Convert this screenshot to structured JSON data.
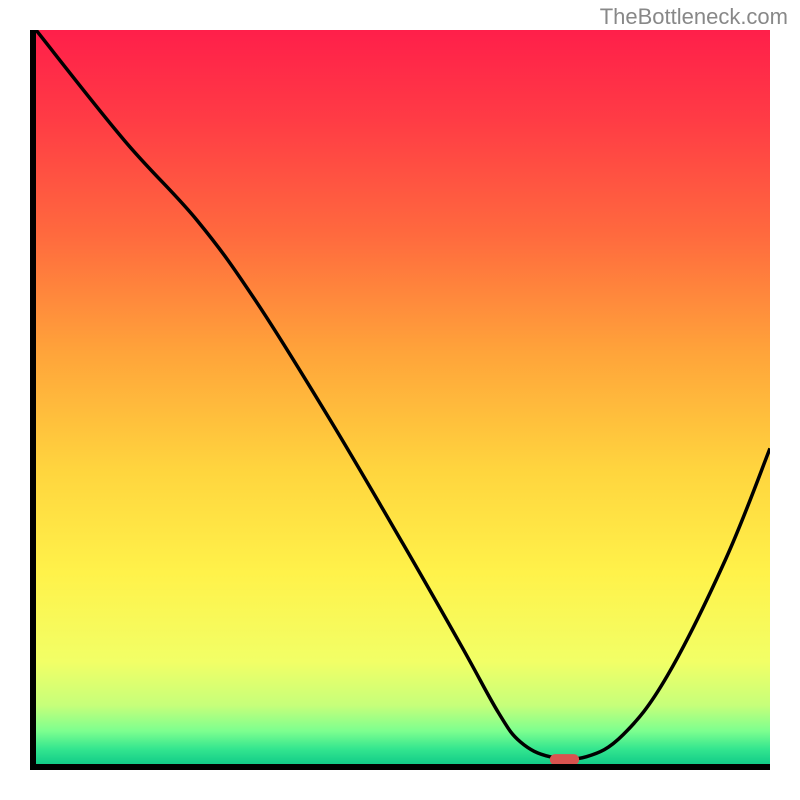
{
  "watermark": "TheBottleneck.com",
  "chart_data": {
    "type": "line",
    "title": "",
    "xlabel": "",
    "ylabel": "",
    "xlim": [
      0,
      100
    ],
    "ylim": [
      0,
      100
    ],
    "series": [
      {
        "name": "curve",
        "x": [
          0,
          12,
          22,
          30,
          40,
          50,
          58,
          63,
          66,
          70,
          75,
          80,
          86,
          94,
          100
        ],
        "values": [
          100,
          85,
          74,
          63,
          47,
          30,
          16,
          7,
          3,
          1,
          1,
          4,
          12,
          28,
          43
        ]
      }
    ],
    "marker": {
      "x": 72,
      "y": 0.6,
      "width": 4,
      "height": 1.5
    },
    "gradient_stops": [
      {
        "offset": 0,
        "color": "#ff1f4a"
      },
      {
        "offset": 0.12,
        "color": "#ff3b45"
      },
      {
        "offset": 0.28,
        "color": "#ff6a3e"
      },
      {
        "offset": 0.44,
        "color": "#ffa43a"
      },
      {
        "offset": 0.6,
        "color": "#ffd53e"
      },
      {
        "offset": 0.74,
        "color": "#fff24a"
      },
      {
        "offset": 0.86,
        "color": "#f2ff66"
      },
      {
        "offset": 0.92,
        "color": "#c6ff7a"
      },
      {
        "offset": 0.955,
        "color": "#7dff8f"
      },
      {
        "offset": 0.98,
        "color": "#33e58f"
      },
      {
        "offset": 1.0,
        "color": "#12cc88"
      }
    ]
  }
}
